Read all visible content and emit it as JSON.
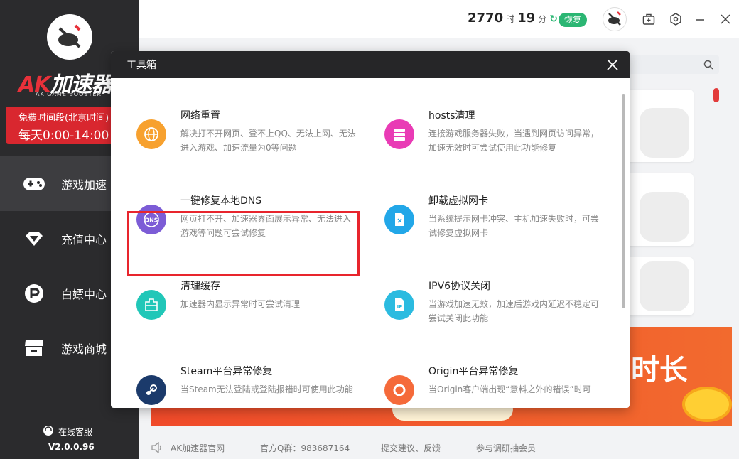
{
  "sidebar": {
    "brand_ak": "AK",
    "brand_rest": "加速器",
    "brand_sub": "AK GAME BOOSTER",
    "free_line1": "免费时间段(北京时间)",
    "free_line2": "每天0:00-14:00",
    "nav": [
      {
        "label": "游戏加速",
        "icon": "gamepad-icon"
      },
      {
        "label": "充值中心",
        "icon": "diamond-icon"
      },
      {
        "label": "白嫖中心",
        "icon": "p-coin-icon"
      },
      {
        "label": "游戏商城",
        "icon": "store-icon"
      }
    ],
    "support": "在线客服",
    "version": "V2.0.0.96"
  },
  "topbar": {
    "hours": "2770",
    "hours_unit": "时",
    "minutes": "19",
    "minutes_unit": "分",
    "restore": "恢复"
  },
  "banner": {
    "text": "时长"
  },
  "footer": {
    "site": "AK加速器官网",
    "qq": "官方Q群：983687164",
    "feedback": "提交建议、反馈",
    "survey": "参与调研抽会员"
  },
  "modal": {
    "title": "工具箱",
    "tools": [
      {
        "name": "网络重置",
        "desc": "解决打不开网页、登不上QQ、无法上网、无法进入游戏、加速流量为0等问题",
        "icon": "globe-icon",
        "color": "#f7a12f"
      },
      {
        "name": "hosts清理",
        "desc": "连接游戏服务器失败，当遇到网页访问异常，加速无效时可尝试使用此功能修复",
        "icon": "server-icon",
        "color": "#e93bb5"
      },
      {
        "name": "一键修复本地DNS",
        "desc": "网页打不开、加速器界面展示异常、无法进入游戏等问题可尝试修复",
        "icon": "dns-icon",
        "color": "#7c5cd6"
      },
      {
        "name": "卸载虚拟网卡",
        "desc": "当系统提示网卡冲突、主机加速失败时，可尝试修复虚拟网卡",
        "icon": "network-card-icon",
        "color": "#22a7e8"
      },
      {
        "name": "清理缓存",
        "desc": "加速器内显示异常时可尝试清理",
        "icon": "cache-icon",
        "color": "#21c7b8"
      },
      {
        "name": "IPV6协议关闭",
        "desc": "当游戏加速无效，加速后游戏内延迟不稳定可尝试关闭此功能",
        "icon": "ip-icon",
        "color": "#2bbbe0"
      },
      {
        "name": "Steam平台异常修复",
        "desc": "当Steam无法登陆或登陆报错时可使用此功能",
        "icon": "steam-icon",
        "color": "#1b3a6b"
      },
      {
        "name": "Origin平台异常修复",
        "desc": "当Origin客户端出现“意料之外的错误”时可",
        "icon": "origin-icon",
        "color": "#f56a3a"
      }
    ]
  }
}
